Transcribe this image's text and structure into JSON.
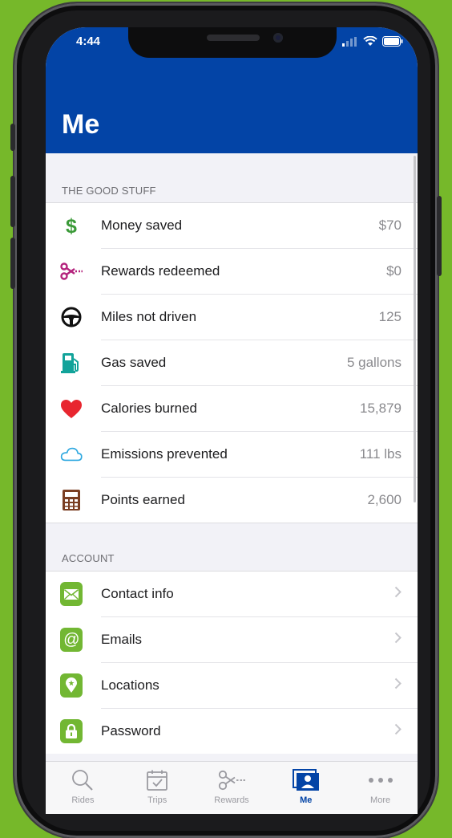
{
  "status_bar": {
    "time": "4:44"
  },
  "header": {
    "title": "Me"
  },
  "good_stuff": {
    "title": "THE GOOD STUFF",
    "items": [
      {
        "icon": "dollar-icon",
        "label": "Money saved",
        "value": "$70"
      },
      {
        "icon": "scissors-coupon-icon",
        "label": "Rewards redeemed",
        "value": "$0"
      },
      {
        "icon": "steering-wheel-icon",
        "label": "Miles not driven",
        "value": "125"
      },
      {
        "icon": "gas-pump-icon",
        "label": "Gas saved",
        "value": "5 gallons"
      },
      {
        "icon": "heart-icon",
        "label": "Calories burned",
        "value": "15,879"
      },
      {
        "icon": "cloud-icon",
        "label": "Emissions prevented",
        "value": "111 lbs"
      },
      {
        "icon": "calculator-icon",
        "label": "Points earned",
        "value": "2,600"
      }
    ]
  },
  "account": {
    "title": "ACCOUNT",
    "items": [
      {
        "icon": "envelope-icon",
        "label": "Contact info"
      },
      {
        "icon": "at-sign-icon",
        "label": "Emails"
      },
      {
        "icon": "location-pin-icon",
        "label": "Locations"
      },
      {
        "icon": "lock-icon",
        "label": "Password"
      }
    ]
  },
  "tabbar": {
    "tabs": [
      {
        "icon": "search-icon",
        "label": "Rides"
      },
      {
        "icon": "calendar-check-icon",
        "label": "Trips"
      },
      {
        "icon": "scissors-coupon-icon",
        "label": "Rewards"
      },
      {
        "icon": "profile-card-icon",
        "label": "Me",
        "active": true
      },
      {
        "icon": "more-dots-icon",
        "label": "More"
      }
    ]
  },
  "colors": {
    "background": "#76b82a",
    "header": "#0344a6",
    "icon_green": "#72b733",
    "heart_red": "#e8262f"
  }
}
